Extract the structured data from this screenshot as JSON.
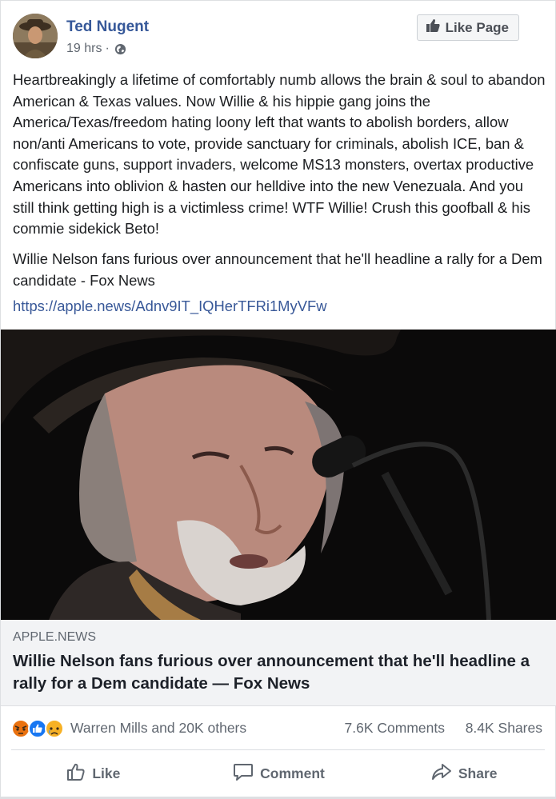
{
  "post": {
    "author": "Ted Nugent",
    "time": "19 hrs",
    "separator": "·",
    "like_page_label": "Like Page",
    "text": "Heartbreakingly a lifetime of comfortably numb allows the brain & soul to abandon American & Texas values. Now Willie & his hippie gang joins the America/Texas/freedom hating loony left that wants to abolish borders, allow non/anti Americans to vote, provide sanctuary for criminals, abolish ICE, ban & confiscate guns, support invaders, welcome MS13 monsters, overtax productive Americans into oblivion & hasten our helldive into the new Venezuala. And you still think getting high is a victimless crime! WTF Willie! Crush this goofball & his commie sidekick Beto!",
    "quote": "Willie Nelson fans furious over announcement that he'll headline a rally for a Dem candidate - Fox News",
    "link": "https://apple.news/Adnv9IT_IQHerTFRi1MyVFw"
  },
  "card": {
    "source": "APPLE.NEWS",
    "title": "Willie Nelson fans furious over announcement that he'll headline a rally for a Dem candidate — Fox News"
  },
  "reactions": {
    "icons": [
      "angry-icon",
      "like-icon",
      "sad-icon"
    ],
    "names": "Warren Mills and 20K others",
    "comments": "7.6K Comments",
    "shares": "8.4K Shares"
  },
  "actions": {
    "like": "Like",
    "comment": "Comment",
    "share": "Share"
  },
  "colors": {
    "link": "#385898",
    "author": "#365899",
    "secondary": "#606770"
  }
}
